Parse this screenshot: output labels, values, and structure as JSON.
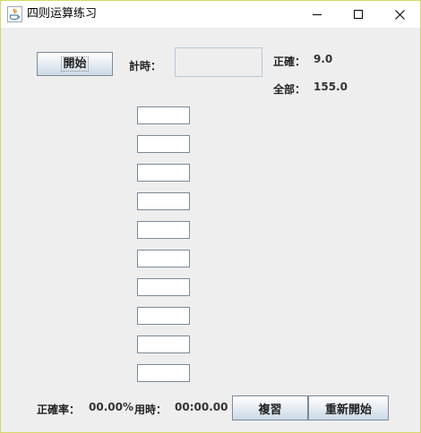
{
  "window": {
    "title": "四则运算练习"
  },
  "toolbar": {
    "start_label": "開始",
    "timer_label": "計時：",
    "timer_value": ""
  },
  "score": {
    "correct_label": "正確：",
    "correct_value": "9.0",
    "total_label": "全部：",
    "total_value": "155.0"
  },
  "answers": [
    "",
    "",
    "",
    "",
    "",
    "",
    "",
    "",
    "",
    ""
  ],
  "footer": {
    "rate_label": "正確率：",
    "rate_value": "00.00%",
    "time_label": "用時：",
    "time_value": "00:00.00",
    "review_label": "複習",
    "restart_label": "重新開始"
  },
  "colors": {
    "titlebar": "#ffffff",
    "background": "#eeeeee",
    "button_border": "#7a8a99"
  }
}
